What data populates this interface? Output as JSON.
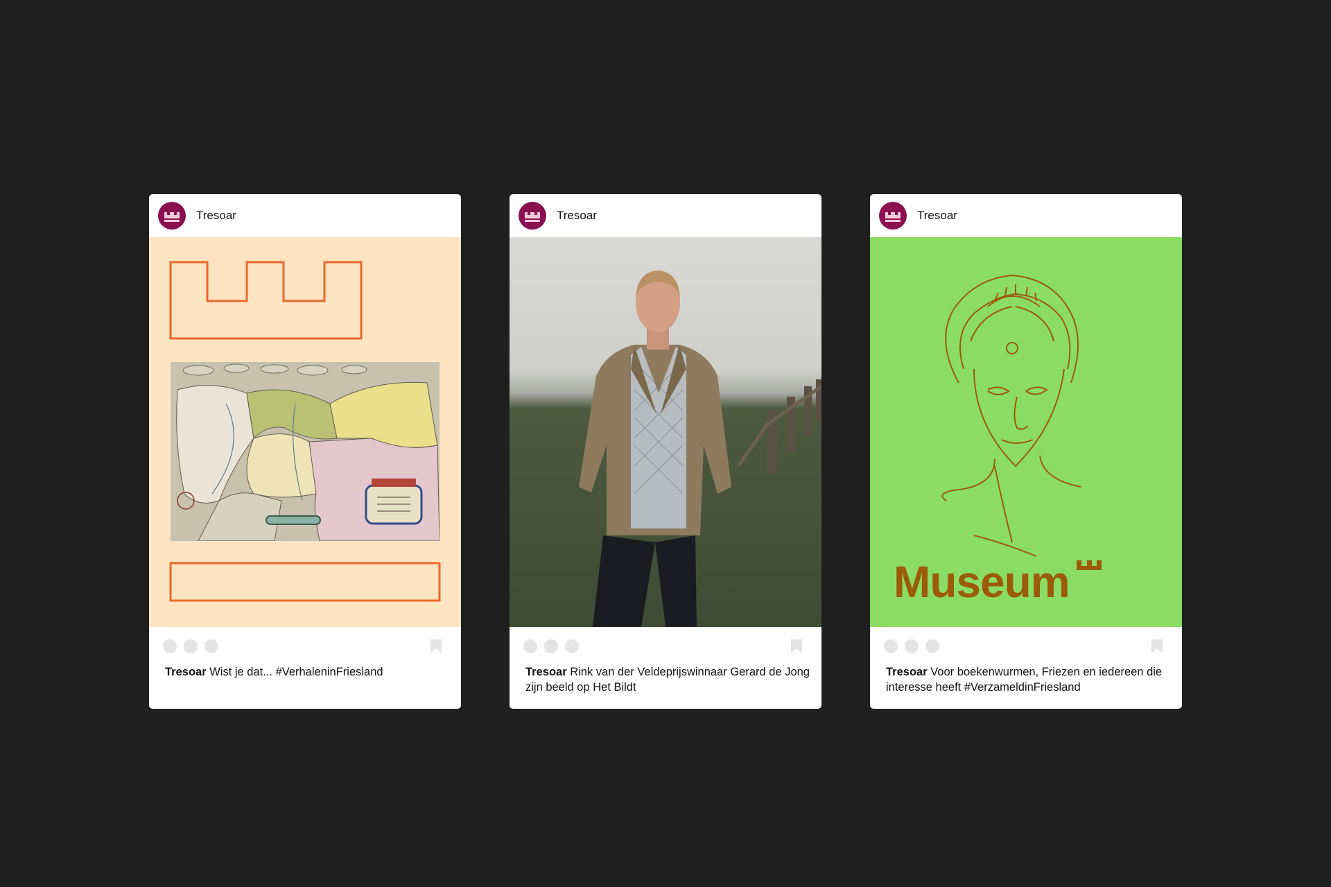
{
  "colors": {
    "background": "#1f1f1f",
    "avatar": "#8a1050",
    "peach": "#ffe4c2",
    "orange_outline": "#e8682a",
    "green": "#8bdc62",
    "museum_brown": "#9b5b08"
  },
  "posts": [
    {
      "account": "Tresoar",
      "avatar_icon": "castle-crown-icon",
      "media": "orange castle outline with antique map of Friesland",
      "caption_author": "Tresoar",
      "caption_text": " Wist je dat... #VerhaleninFriesland"
    },
    {
      "account": "Tresoar",
      "avatar_icon": "castle-crown-icon",
      "media": "portrait photo of man in corduroy jacket in a field",
      "caption_author": "Tresoar",
      "caption_text": " Rink van der Veldeprijswinnaar Gerard de Jong zijn beeld op Het Bildt"
    },
    {
      "account": "Tresoar",
      "avatar_icon": "castle-crown-icon",
      "media": "line drawing of woman on green background",
      "media_word": "Museum",
      "caption_author": "Tresoar",
      "caption_text": " Voor boekenwurmen, Friezen en iedereen die interesse heeft #VerzameldinFriesland"
    }
  ]
}
